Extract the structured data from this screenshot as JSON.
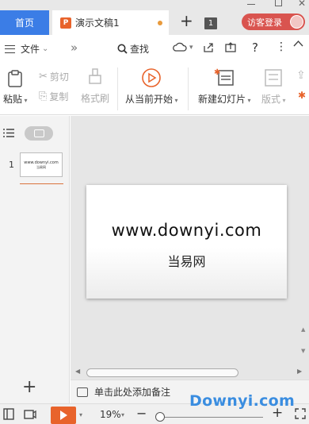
{
  "tabs": {
    "home_label": "首页",
    "doc_label": "演示文稿1",
    "doc_icon_letter": "P",
    "tab_count": "1"
  },
  "account": {
    "visitor_label": "访客登录"
  },
  "menu": {
    "file_label": "文件",
    "more_glyph": "»",
    "search_label": "查找",
    "help_glyph": "?",
    "kebab_glyph": "⋮",
    "collapse_glyph": "︿"
  },
  "ribbon": {
    "paste_label": "粘贴",
    "cut_label": "剪切",
    "copy_label": "复制",
    "format_brush_label": "格式刷",
    "play_from_current_label": "从当前开始",
    "new_slide_label": "新建幻灯片",
    "layout_label": "版式"
  },
  "slides_panel": {
    "slide_number": "1",
    "thumb_title": "www.downyi.com",
    "thumb_subtitle": "当易网",
    "add_glyph": "+"
  },
  "slide": {
    "title": "www.downyi.com",
    "subtitle": "当易网"
  },
  "notes": {
    "placeholder": "单击此处添加备注"
  },
  "status": {
    "zoom_label": "19%",
    "zoom_minus": "−",
    "zoom_plus": "+",
    "zoom_percent": 19
  },
  "watermark": {
    "text": "Downyi.com"
  },
  "colors": {
    "accent": "#3b7de6",
    "doc_orange": "#e8632b",
    "login_red": "#d9544f",
    "watermark_blue": "#3a8de0"
  }
}
